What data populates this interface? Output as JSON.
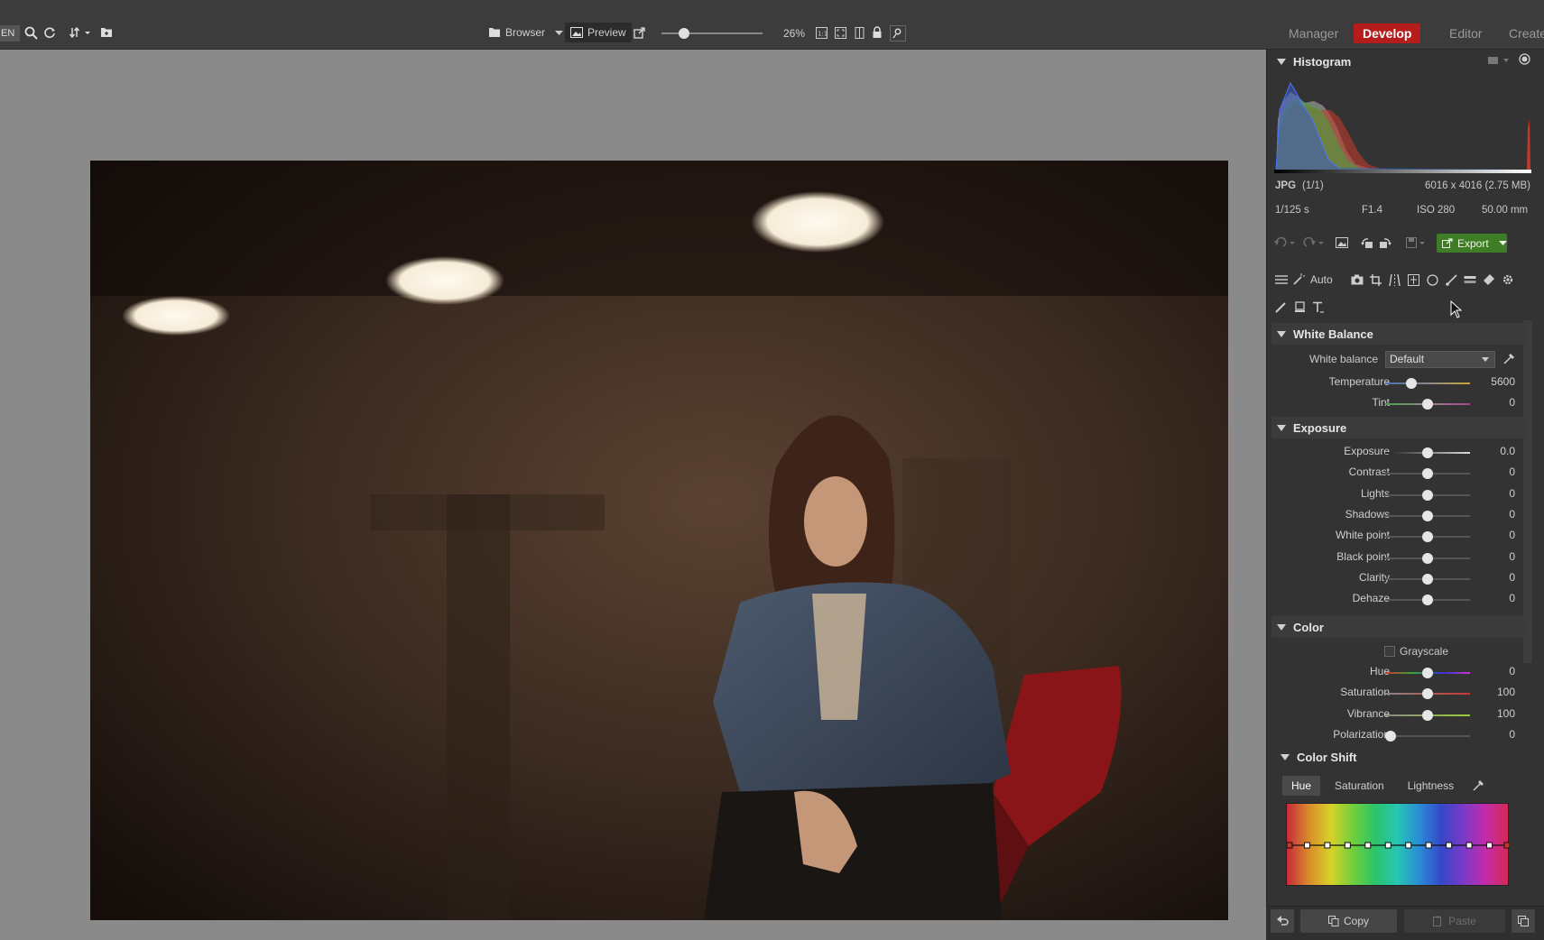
{
  "toolbar": {
    "lang": "EN",
    "browser_label": "Browser",
    "preview_label": "Preview",
    "zoom_level": 0.22,
    "zoom_percent": "26%"
  },
  "modes": {
    "manager": "Manager",
    "develop": "Develop",
    "editor": "Editor",
    "create": "Create"
  },
  "histogram": {
    "title": "Histogram",
    "format": "JPG",
    "count": "(1/1)",
    "dimensions": "6016 x 4016 (2.75 MB)",
    "shutter": "1/125 s",
    "aperture": "F1.4",
    "iso": "ISO 280",
    "focal": "50.00 mm"
  },
  "actions": {
    "export_label": "Export"
  },
  "tools": {
    "auto_label": "Auto"
  },
  "white_balance": {
    "title": "White Balance",
    "wb_label": "White balance",
    "wb_value": "Default",
    "rows": [
      {
        "label": "Temperature",
        "value": "5600",
        "pos": 0.31
      },
      {
        "label": "Tint",
        "value": "0",
        "pos": 0.5
      }
    ]
  },
  "exposure": {
    "title": "Exposure",
    "rows": [
      {
        "label": "Exposure",
        "value": "0.0",
        "pos": 0.5
      },
      {
        "label": "Contrast",
        "value": "0",
        "pos": 0.5
      },
      {
        "label": "Lights",
        "value": "0",
        "pos": 0.5
      },
      {
        "label": "Shadows",
        "value": "0",
        "pos": 0.5
      },
      {
        "label": "White point",
        "value": "0",
        "pos": 0.5
      },
      {
        "label": "Black point",
        "value": "0",
        "pos": 0.5
      },
      {
        "label": "Clarity",
        "value": "0",
        "pos": 0.5
      },
      {
        "label": "Dehaze",
        "value": "0",
        "pos": 0.5
      }
    ]
  },
  "color": {
    "title": "Color",
    "grayscale_label": "Grayscale",
    "rows": [
      {
        "label": "Hue",
        "value": "0",
        "pos": 0.5
      },
      {
        "label": "Saturation",
        "value": "100",
        "pos": 0.5
      },
      {
        "label": "Vibrance",
        "value": "100",
        "pos": 0.5
      },
      {
        "label": "Polarization",
        "value": "0",
        "pos": 0.06
      }
    ]
  },
  "color_shift": {
    "title": "Color Shift",
    "tabs": [
      "Hue",
      "Saturation",
      "Lightness"
    ],
    "active_tab": "Hue"
  },
  "bottom": {
    "copy_label": "Copy",
    "paste_label": "Paste"
  },
  "colors": {
    "accent": "#b51c1c",
    "export_green": "#3e7d25"
  }
}
